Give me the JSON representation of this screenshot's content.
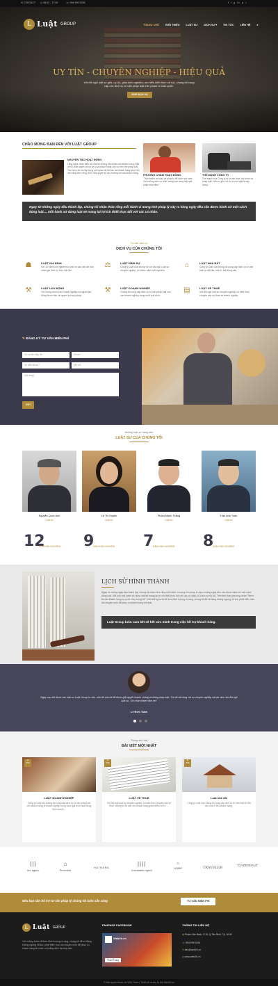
{
  "topbar": {
    "contact": "CONTACT",
    "hours": "08:00 - 17:00",
    "phone": "094 999 9295",
    "social": "f  t  g  in  p  ⌕"
  },
  "brand": {
    "mark": "L",
    "name": "Luật",
    "suffix": "GROUP"
  },
  "nav": [
    "TRANG CHỦ",
    "GIỚI THIỆU",
    "LUẬT SƯ",
    "DỊCH VỤ ▾",
    "TIN TỨC",
    "LIÊN HỆ"
  ],
  "hero": {
    "title": "UY TÍN - CHUYÊN NGHIỆP - HIỆU QUẢ",
    "subtitle": "Với đội ngũ luật sư giỏi, uy tín, giàu kinh nghiệm, am hiểu kiến thức xã hội, chúng tôi cung cấp các dịch vụ tư vấn pháp luật trên phạm vi toàn quốc.",
    "button": "XEM DỊCH VỤ"
  },
  "welcome": {
    "title": "CHÀO MỪNG BẠN ĐẾN VỚI LUẬT GROUP",
    "about_title": "NGUYÊN TẮC HOẠT ĐỘNG",
    "about_text": "Lắng nghe, thấu hiểu và chia sẻ những khó khăn của khách hàng. Bảo vệ tối chất quyền và lợi ích của khách hàng căn cứ trên thế pháp luật. Tạo niềm tin và xây dựng mối quan hệ đối tác với khách hàng dựa trên nền tảng bền vững, theo một quyết độ các hướng tới của khách hàng.",
    "col2_title": "PHƯƠNG CHÂM HOẠT ĐỘNG",
    "col2_text": "\"Trân thành an toàn và pháp lý để dành với nam. Với những dịch vụ chất lượng cao cung cấp giải pháp toàn diện.\"",
    "col3_title": "THẾ MẠNH CÔNG TY",
    "col3_text": "Thế mạnh của Công ty là tư vấn thuế, tài chính và pháp luật, luật sư giỏi, hỗ trợ tìm lời giải là xây dựng.",
    "quote": "Ngay từ những ngày đầu thành lập, chúng tôi nhận thức rằng mỗi hành vi mang tính pháp lý xảy ra hàng ngày đều cần được hành xử một cách đúng luật..., mỗi hành xử đúng luật sẽ mang lại lợi ích thiết thực đối với các cá nhân."
  },
  "services": {
    "kicker": "Tư vấn dịch vụ",
    "title": "DỊCH VỤ CỦA CHÚNG TÔI",
    "items": [
      {
        "icon": "family-icon",
        "glyph": "☗",
        "title": "LUẬT GIA ĐÌNH",
        "desc": "Với 10 năm kinh nghiệm tư vấn về các vấn đề hôn nhân gia đình, ly hôn, đất đai."
      },
      {
        "icon": "scales-icon",
        "glyph": "⚖",
        "title": "LUẬT HÌNH SỰ",
        "desc": "Công ty Luật của chúng tôi với đội ngũ Luật sư chuyên nghiệp, có nhiều năm kinh nghiệm."
      },
      {
        "icon": "house-icon",
        "glyph": "⌂",
        "title": "LUẬT NHÀ ĐẤT",
        "desc": "Công ty Luật của chúng tôi cung cấp dịch vụ tư vấn luật về đất đai, nhà ở, bất động sản."
      },
      {
        "icon": "worker-icon",
        "glyph": "⚒",
        "title": "LUẬT LAO ĐỘNG",
        "desc": "Với mong muốn các Doanh nghiệp và người lao động được bảo vệ quyền lợi hợp pháp."
      },
      {
        "icon": "gavel-icon",
        "glyph": "⚒",
        "title": "LUẬT DOANH NGHIỆP",
        "desc": "Chúng tôi cung cấp dịch vụ tư vấn pháp luật cho các doanh nghiệp trong suốt quá trình."
      },
      {
        "icon": "document-icon",
        "glyph": "▤",
        "title": "LUẬT VỀ THUẾ",
        "desc": "Với đội ngũ luật sư chuyên nghiệp, có kiến thức chuyên sâu về thuế và doanh nghiệp."
      }
    ]
  },
  "consult": {
    "title": "ĐĂNG KÝ TƯ VẤN MIỄN PHÍ",
    "name_ph": "Họ và tên đầy đủ *",
    "email_ph": "Email *",
    "phone_ph": "Số điện thoại *",
    "address_ph": "Địa chỉ",
    "message_ph": "Nội dung",
    "submit": "GỬI"
  },
  "lawyers": {
    "kicker": "Những luật sư hàng đầu",
    "title": "LUẬT SƯ CỦA CHÚNG TÔI",
    "items": [
      {
        "name": "Nguyễn Quốc Anh",
        "role": "Luật sư",
        "years": "12",
        "label": "NĂM KINH NGHIỆM"
      },
      {
        "name": "Lê Thị Huyền",
        "role": "Luật sư",
        "years": "9",
        "label": "NĂM KINH NGHIỆM"
      },
      {
        "name": "Phạm Mạnh Thắng",
        "role": "Luật sư",
        "years": "7",
        "label": "NĂM KINH NGHIỆM"
      },
      {
        "name": "Trần Anh Tuấn",
        "role": "Luật sư",
        "years": "8",
        "label": "NĂM KINH NGHIỆM"
      }
    ]
  },
  "history": {
    "title": "LỊCH SỬ HÌNH THÀNH",
    "text": "Ngay từ những ngày đầu thành lập, chúng tôi nhận thức rằng mỗi hành vi mang tính pháp lý xảy ra hàng ngày đều cần được hành xử một cách đúng luật. Mỗi một mối hành xử đúng luật sẽ mang lại lợi ích thiết thực đối với các cá nhân, tổ chức và xã hội. Trên tinh thần phương châm \"Niềm tin của khách hàng là uy tín của chúng tôi\". Với những bước đi theo định hướng rõ ràng, chúng tôi đã và đang không ngừng nỗ lực, phát triển, trau dồi chuyên môn để phục vụ khách hàng tốt nhất.",
    "highlight": "Luật Group luôn cam kết sẽ hết sức mình trong việc hỗ trợ khách hàng."
  },
  "testimonial": {
    "quote": "Ngay sau khi được các luật sư Luật Group tư vấn, vấn đề của tôi đã được giải quyết nhanh chóng và đúng pháp luật. Tôi rất hài lòng với sự chuyên nghiệp và tận tâm của đội ngũ luật sư. Xin chân thành cảm ơn!",
    "name": "Lê Đức Tuấn"
  },
  "news": {
    "kicker": "Thông tin Luật",
    "title": "BÀI VIẾT MỚI NHẤT",
    "items": [
      {
        "day": "11",
        "month": "Th6",
        "title": "LUẬT DOANH NGHIỆP",
        "text": "Công ty Luật của chúng tôi cung cấp dịch vụ tư vấn pháp luật cho khách hàng là doanh nghiệp trong suốt quá trình hoạt động kinh doanh..."
      },
      {
        "day": "11",
        "month": "Th6",
        "title": "LUẬT VỀ THUẾ",
        "text": "Với đội ngũ luật sư chuyên nghiệp, có kiến thức chuyên sâu về thuế, chúng tôi tư vấn cho khách hàng giảm thiểu rủi ro, ..."
      },
      {
        "day": "11",
        "month": "Th6",
        "title": "Luật nhà đất",
        "text": "Công ty Luật của chúng tôi cung cấp dịch vụ tư vấn luật về đất đai, nhà ở cho khách hàng."
      }
    ]
  },
  "partners": [
    "bie agent.",
    "Pinecrest",
    "HATHANA",
    "investable agent",
    "HOME",
    "TRAVELER",
    "CLYDESDALE"
  ],
  "cta": {
    "text": "Nếu bạn cần hỗ trợ tư vấn pháp lý chúng tôi luôn sẵn sàng",
    "button": "TƯ VẤN MIỄN PHÍ"
  },
  "footer": {
    "about": "Với những bước đi theo định hướng rõ ràng, chúng tôi đã và đang không ngừng nỗ lực, phát triển, trau dồi chuyên môn để phục vụ khách hàng tốt nhất, và khẳng định thương hiệu.",
    "fb_title": "FANPAGE FACEBOOK",
    "fb_name": "Web2h.vn",
    "fb_button": "Thích Trang",
    "contact_title": "THÔNG TIN LIÊN HỆ",
    "address": "Phạm Văn Bạch, P.15, Q.Tân Bình, Tp. HCM",
    "phone": "094 999 9295",
    "email": "info@web2h.vn",
    "site": "www.web2h.vn",
    "copyright": "© Bản quyền thuộc về W2h Team | Thiết kế và duy trì bởi Web2h.vn"
  },
  "colors": {
    "accent": "#b08b3a",
    "dark": "#3b3a4d"
  }
}
